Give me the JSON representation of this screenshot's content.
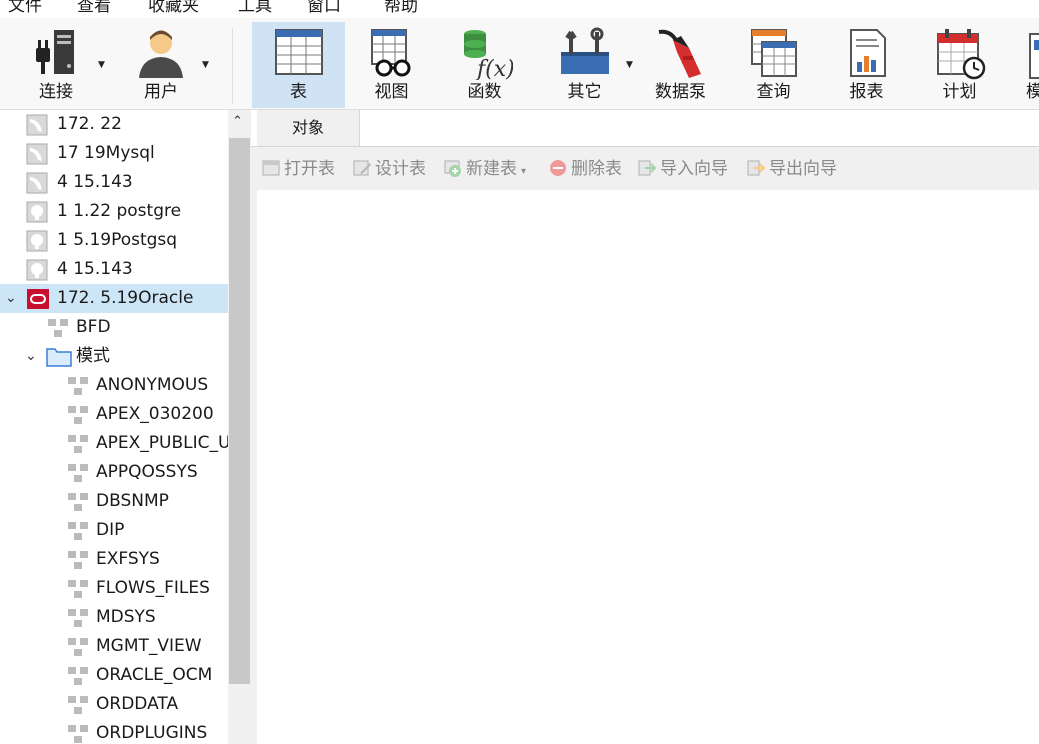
{
  "menu": [
    "文件",
    "查看",
    "收藏夹",
    "工具",
    "窗口",
    "帮助"
  ],
  "toolbar": {
    "connect": "连接",
    "user": "用户",
    "table": "表",
    "view": "视图",
    "function": "函数",
    "other": "其它",
    "datapump": "数据泵",
    "query": "查询",
    "report": "报表",
    "schedule": "计划",
    "more": "模"
  },
  "tree": {
    "connections": [
      {
        "label": "172.     22",
        "type": "mysql"
      },
      {
        "label": "17       19Mysql",
        "type": "mysql"
      },
      {
        "label": "4        15.143",
        "type": "mysql"
      },
      {
        "label": "1        1.22 postgre",
        "type": "postgres"
      },
      {
        "label": "1        5.19Postgsq",
        "type": "postgres"
      },
      {
        "label": "4        15.143",
        "type": "postgres"
      },
      {
        "label": "172.    5.19Oracle",
        "type": "oracle",
        "expanded": true
      }
    ],
    "database": "BFD",
    "schema_folder": "模式",
    "schemas": [
      "ANONYMOUS",
      "APEX_030200",
      "APEX_PUBLIC_U",
      "APPQOSSYS",
      "DBSNMP",
      "DIP",
      "EXFSYS",
      "FLOWS_FILES",
      "MDSYS",
      "MGMT_VIEW",
      "ORACLE_OCM",
      "ORDDATA",
      "ORDPLUGINS"
    ]
  },
  "tabs": {
    "objects": "对象"
  },
  "objbar": {
    "open": "打开表",
    "design": "设计表",
    "new": "新建表",
    "delete": "删除表",
    "import": "导入向导",
    "export": "导出向导"
  },
  "colors": {
    "accent": "#cfe3f5",
    "selection": "#cde6f7",
    "oracle": "#c8102e",
    "table_header": "#3b6db3"
  }
}
